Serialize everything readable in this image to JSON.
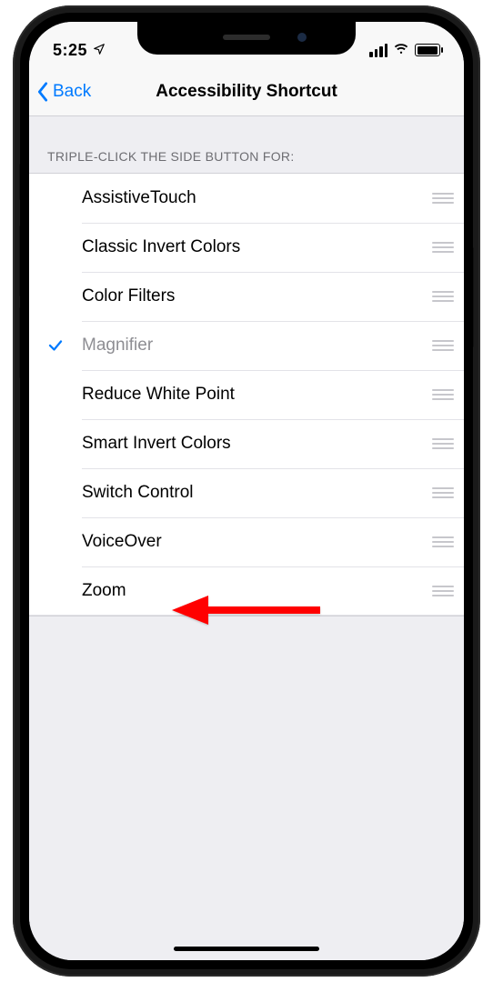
{
  "status": {
    "time": "5:25"
  },
  "nav": {
    "back_label": "Back",
    "title": "Accessibility Shortcut"
  },
  "section": {
    "header": "TRIPLE-CLICK THE SIDE BUTTON FOR:"
  },
  "options": [
    {
      "label": "AssistiveTouch",
      "selected": false
    },
    {
      "label": "Classic Invert Colors",
      "selected": false
    },
    {
      "label": "Color Filters",
      "selected": false
    },
    {
      "label": "Magnifier",
      "selected": true
    },
    {
      "label": "Reduce White Point",
      "selected": false
    },
    {
      "label": "Smart Invert Colors",
      "selected": false
    },
    {
      "label": "Switch Control",
      "selected": false
    },
    {
      "label": "VoiceOver",
      "selected": false
    },
    {
      "label": "Zoom",
      "selected": false
    }
  ],
  "annotation": {
    "target_index": 8,
    "color": "#ff0000"
  }
}
